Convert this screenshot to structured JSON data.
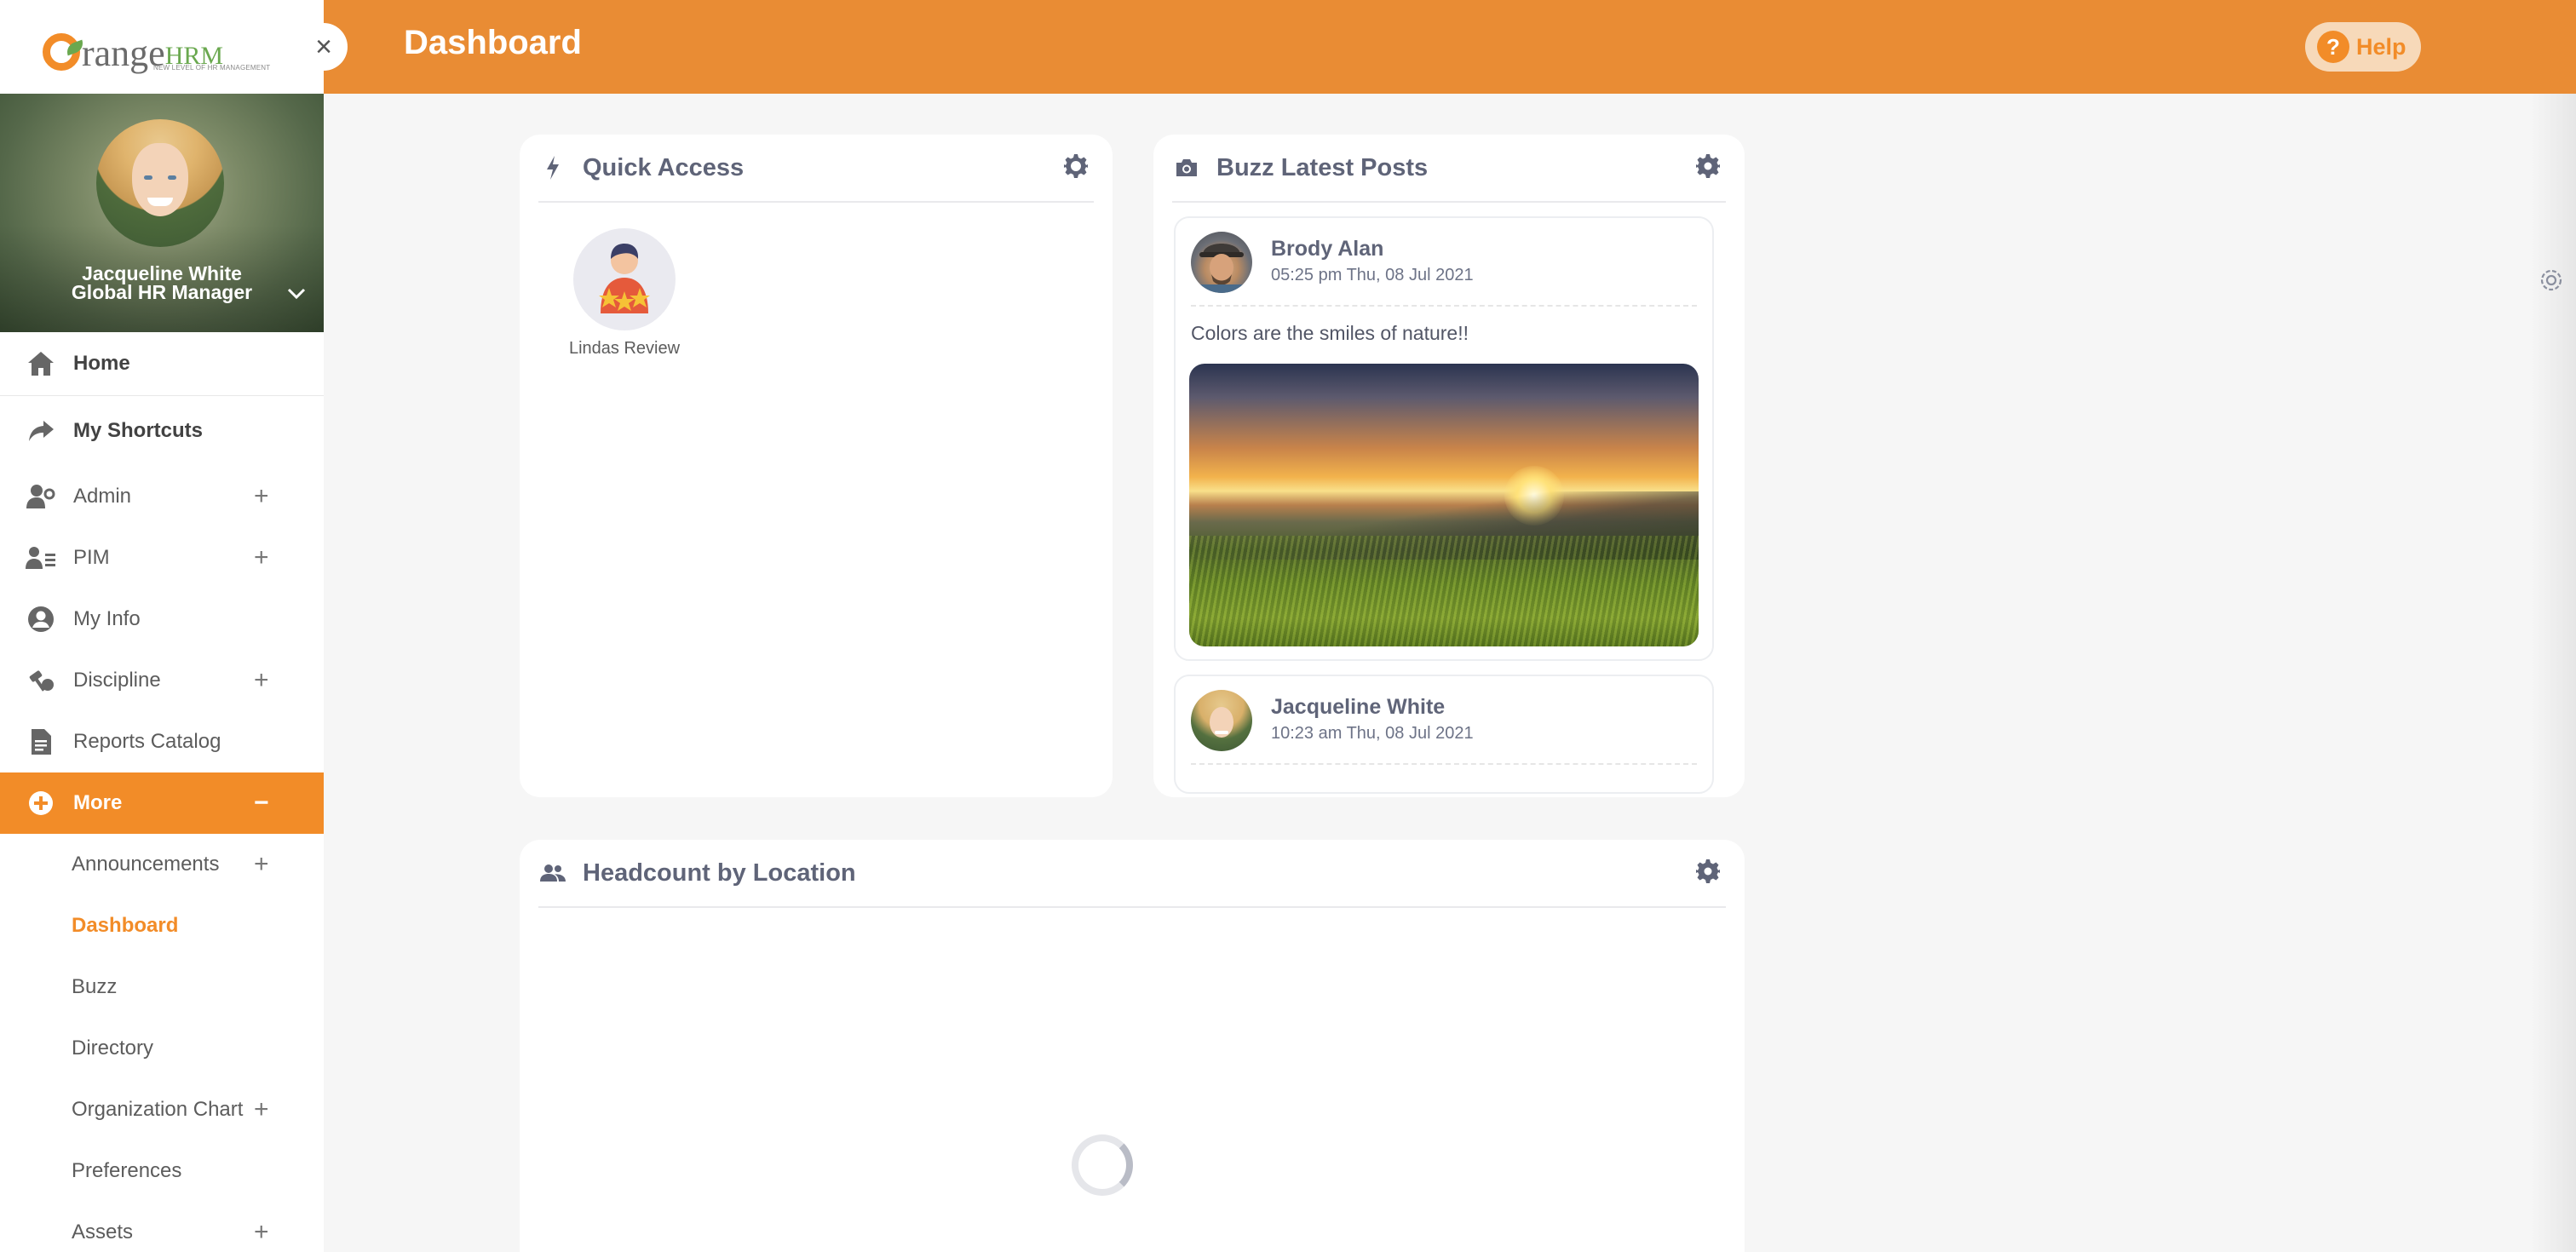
{
  "app": {
    "logo_text_main": "range",
    "logo_text_hrm": "HRM",
    "logo_tagline": "NEW LEVEL OF HR MANAGEMENT",
    "colors": {
      "accent": "#e98c34",
      "sidebar_active": "#f28c28",
      "card_title": "#5f6478"
    }
  },
  "topbar": {
    "title": "Dashboard",
    "help_label": "Help",
    "help_icon": "?",
    "close_icon": "×"
  },
  "profile": {
    "name": "Jacqueline White",
    "role": "Global HR Manager"
  },
  "sidebar": {
    "items": [
      {
        "label": "Home",
        "icon": "home-icon"
      },
      {
        "label": "My Shortcuts",
        "icon": "share-arrow-icon"
      },
      {
        "label": "Admin",
        "icon": "user-gear-icon",
        "expandable": true
      },
      {
        "label": "PIM",
        "icon": "id-card-icon",
        "expandable": true
      },
      {
        "label": "My Info",
        "icon": "user-circle-icon"
      },
      {
        "label": "Discipline",
        "icon": "gavel-icon",
        "expandable": true
      },
      {
        "label": "Reports Catalog",
        "icon": "report-file-icon"
      },
      {
        "label": "More",
        "icon": "plus-circle-icon",
        "expanded": true
      }
    ],
    "sub_items": [
      {
        "label": "Announcements",
        "expandable": true
      },
      {
        "label": "Dashboard",
        "active": true
      },
      {
        "label": "Buzz"
      },
      {
        "label": "Directory"
      },
      {
        "label": "Organization Chart",
        "expandable": true
      },
      {
        "label": "Preferences"
      },
      {
        "label": "Assets",
        "expandable": true
      }
    ],
    "plus_symbol": "+",
    "minus_symbol": "−"
  },
  "quick_access": {
    "title": "Quick Access",
    "items": [
      {
        "label": "Lindas Review",
        "icon": "review-stars-icon"
      }
    ]
  },
  "buzz": {
    "title": "Buzz Latest Posts",
    "posts": [
      {
        "author": "Brody Alan",
        "time": "05:25 pm Thu, 08 Jul 2021",
        "text": "Colors are the smiles of nature!!"
      },
      {
        "author": "Jacqueline White",
        "time": "10:23 am Thu, 08 Jul 2021"
      }
    ]
  },
  "headcount": {
    "title": "Headcount by Location"
  }
}
